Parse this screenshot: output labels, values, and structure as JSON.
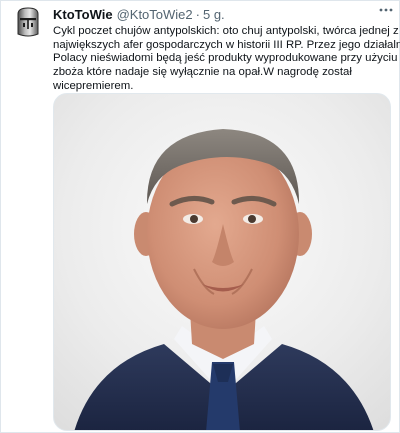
{
  "tweet": {
    "author_name": "KtoToWie",
    "author_handle": "@KtoToWie2",
    "separator": "·",
    "time": "5 g.",
    "text_lines": [
      "Cykl poczet chujów antypolskich: oto chuj antypolski, twórca jednej z",
      "największych afer gospodarczych w historii III RP. Przez jego działalność",
      "Polacy nieświadomi będą jeść produkty wyprodukowane przy użyciu",
      "zboża które nadaje się wyłącznie na opał.W nagrodę został",
      "wicepremierem."
    ],
    "icons": {
      "avatar": "knight-helmet-icon",
      "more": "more-options-icon"
    }
  },
  "colors": {
    "text": "#0f1419",
    "secondary": "#536471",
    "photo_bg": "#ececec"
  }
}
